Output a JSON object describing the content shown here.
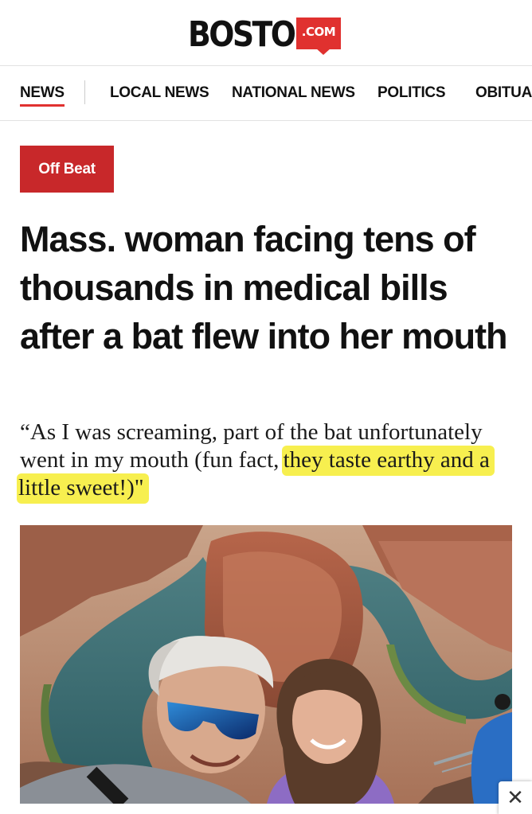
{
  "logo": {
    "wordmark": "BOSTON",
    "badge": ".COM",
    "brand_color": "#e0312f"
  },
  "nav": {
    "items": [
      {
        "label": "NEWS",
        "active": true
      },
      {
        "label": "LOCAL NEWS",
        "active": false
      },
      {
        "label": "NATIONAL NEWS",
        "active": false
      },
      {
        "label": "POLITICS",
        "active": false
      },
      {
        "label": "OBITUAR",
        "active": false
      }
    ]
  },
  "article": {
    "section_tag": "Off Beat",
    "section_tag_color": "#c8282a",
    "headline": "Mass. woman facing tens of thousands in medical bills after a bat flew into her mouth",
    "dek_plain": "“As I was screaming, part of the bat unfortunately went in my mouth (fun fact, ",
    "dek_highlighted": "they taste earthy and a little sweet!)\"",
    "highlight_color": "#f7ef4f",
    "hero_image": "photo-selfie-canyon"
  },
  "overlay": {
    "close_icon": "close-icon",
    "close_glyph": "✕"
  }
}
